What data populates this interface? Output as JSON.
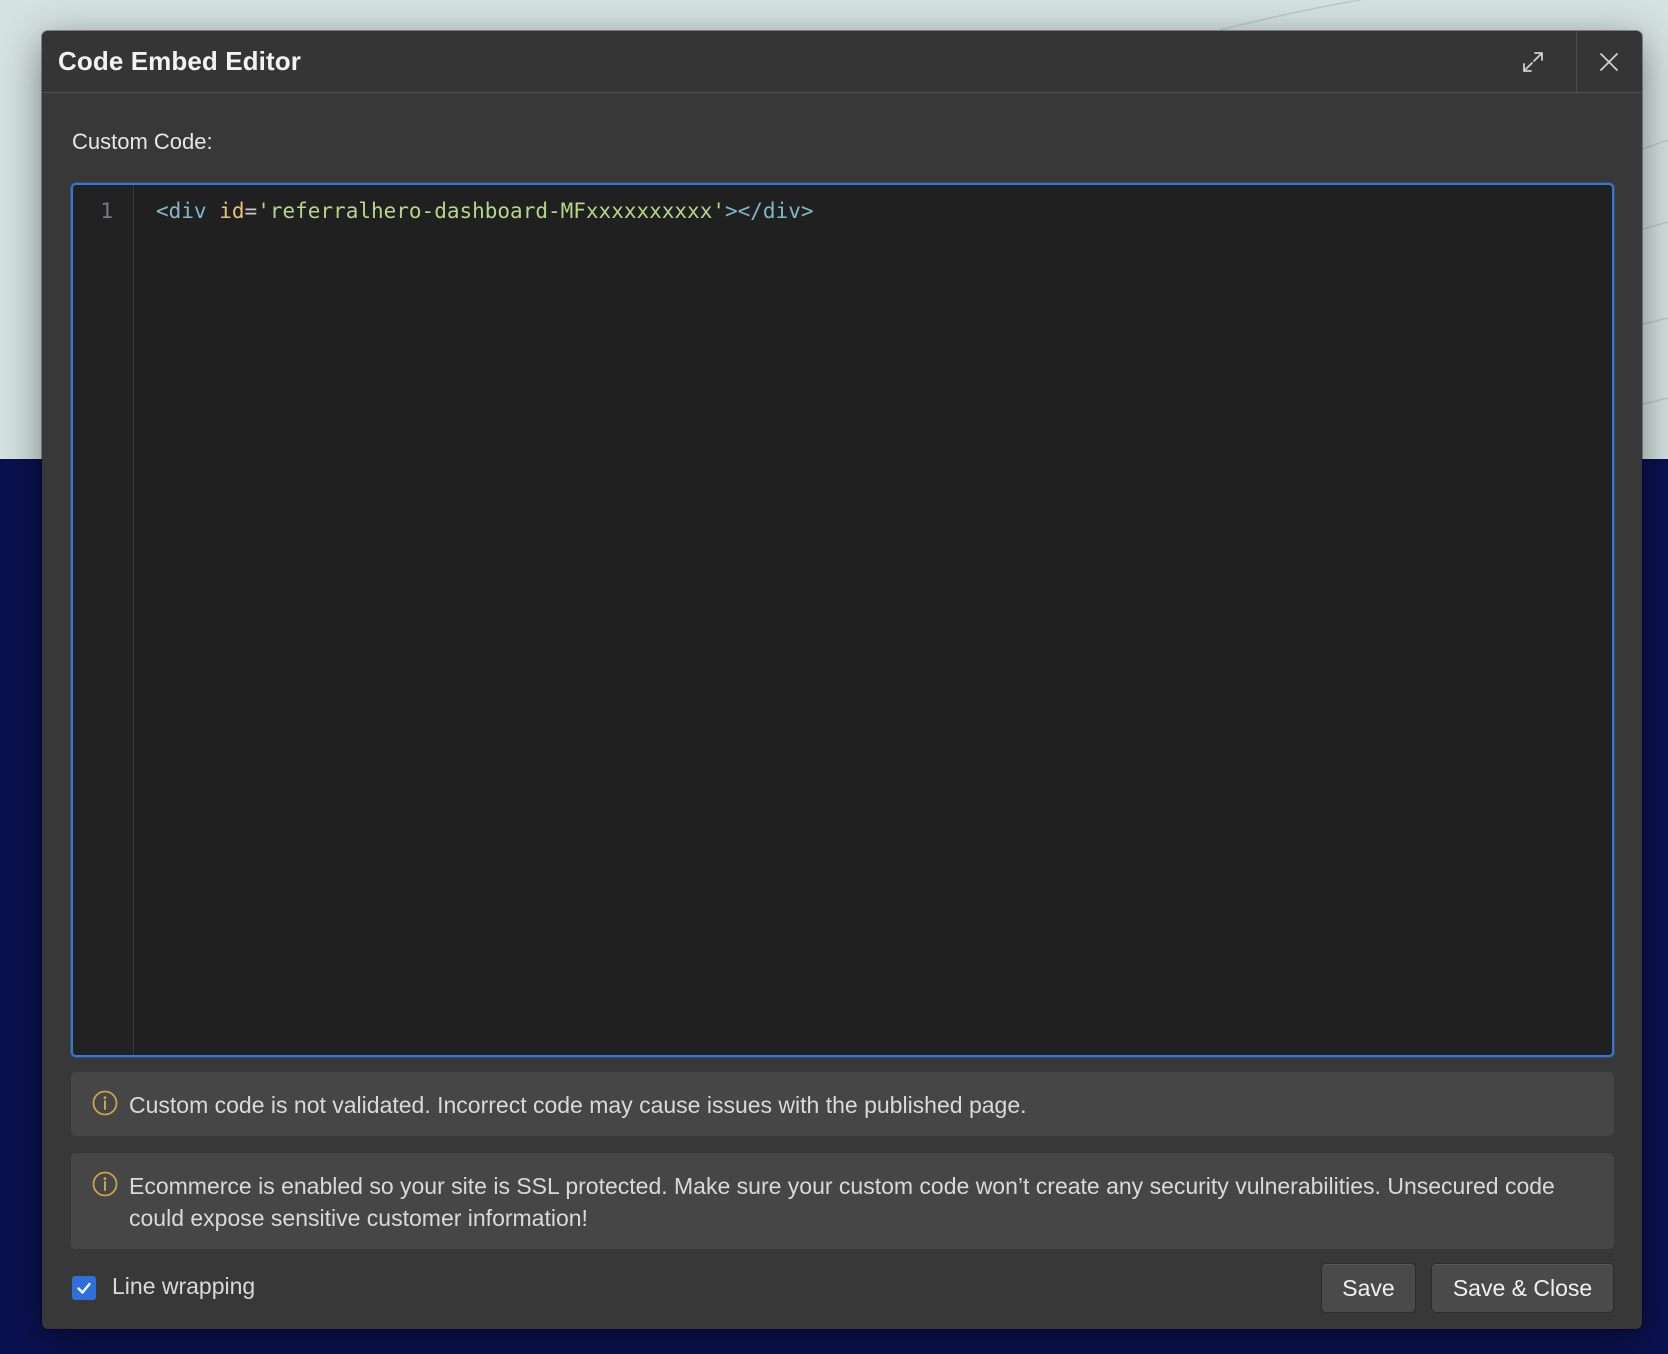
{
  "modal": {
    "title": "Code Embed Editor"
  },
  "editor": {
    "label": "Custom Code:",
    "line_number": "1",
    "code": {
      "tag_open": "<div",
      "attr_name": "id",
      "equals": "=",
      "attr_value": "'referralhero-dashboard-MFxxxxxxxxxx'",
      "tag_close": "></div>"
    }
  },
  "notices": [
    {
      "text": "Custom code is not validated. Incorrect code may cause issues with the published page."
    },
    {
      "text": "Ecommerce is enabled so your site is SSL protected. Make sure your custom code won’t create any security vulnerabilities. Unsecured code could expose sensitive customer information!"
    }
  ],
  "footer": {
    "line_wrapping_label": "Line wrapping",
    "line_wrapping_checked": true,
    "save_label": "Save",
    "save_close_label": "Save & Close"
  },
  "colors": {
    "accent": "#2f6fdb",
    "warning_icon": "#c9a64a",
    "modal_bg": "#383838",
    "editor_bg": "#202020"
  },
  "icons": {
    "expand": "expand-icon",
    "close": "close-icon",
    "info": "info-icon",
    "check": "check-icon"
  }
}
